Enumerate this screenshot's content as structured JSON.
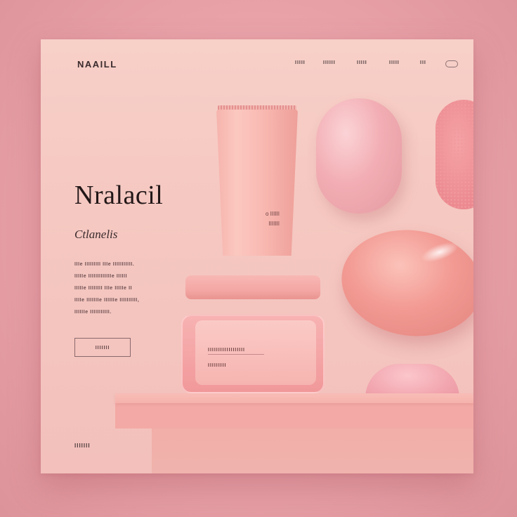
{
  "header": {
    "brand": "NAAILL",
    "nav": [
      "IIIII",
      "IIIIII",
      "IIIII",
      "IIIII",
      "III"
    ]
  },
  "hero": {
    "title": "Nralacil",
    "subtitle": "Ctlanelis",
    "body_lines": [
      "IIIe IIIIIIIII IIIe IIIIIIIIIII.",
      "IIIIIe IIIIIIIIIIIIIe IIIIII",
      "IIIIIe IIIIIIII IIIe IIIIIe II",
      "IIIIe IIIIIIIe IIIIIIe IIIIIIIIII,",
      "IIIIIIe IIIIIIIIIII."
    ],
    "cta_label": "IIIIIII",
    "footer_label": "IIIIIII"
  },
  "products": {
    "tube_label_line1": "o IIIIII",
    "tube_label_line2": "IIIIIII",
    "jar_label_line1": "IIIIIIIIIIIIIIIIII",
    "jar_label_line2": "IIIIIIIII"
  }
}
